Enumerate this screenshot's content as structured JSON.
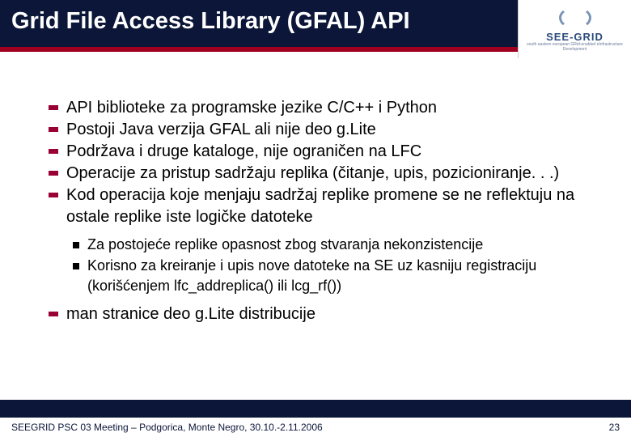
{
  "header": {
    "title": "Grid File Access Library (GFAL) API",
    "logo": {
      "name": "SEE-GRID",
      "sub": "south eastern european GRid-enabled eInfrastructure Development"
    }
  },
  "bullets": {
    "b0": "API biblioteke za programske jezike C/C++ i Python",
    "b1": "Postoji Java verzija GFAL ali nije deo g.Lite",
    "b2": "Podržava i druge kataloge, nije ograničen na LFC",
    "b3": "Operacije za pristup sadržaju replika (čitanje, upis, pozicioniranje. . .)",
    "b4": "Kod operacija koje menjaju sadržaj replike promene se ne reflektuju na ostale replike iste logičke datoteke",
    "s0": "Za postojeće replike opasnost zbog stvaranja nekonzistencije",
    "s1": "Korisno za kreiranje i upis nove datoteke na SE uz kasniju registraciju (korišćenjem lfc_addreplica() ili lcg_rf())",
    "b5": "man stranice deo g.Lite distribucije"
  },
  "footer": {
    "left": "SEEGRID PSC 03 Meeting – Podgorica, Monte Negro, 30.10.-2.11.2006",
    "right": "23"
  }
}
